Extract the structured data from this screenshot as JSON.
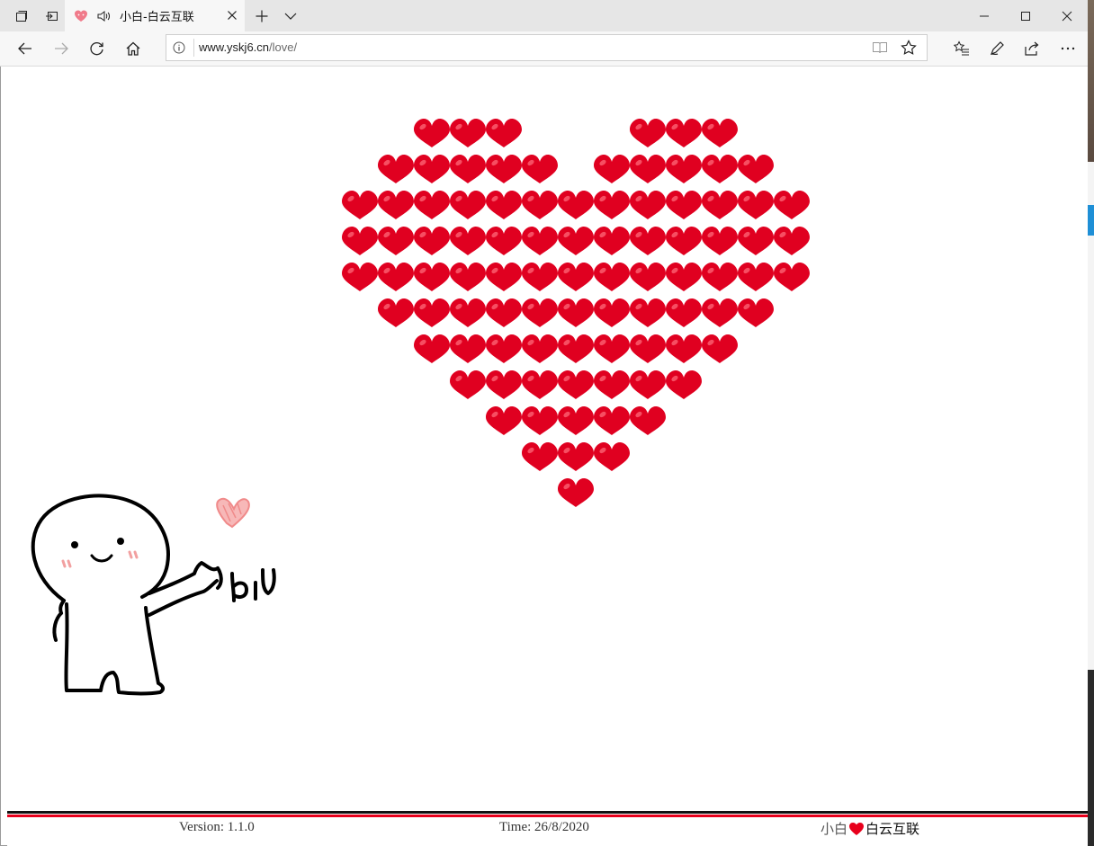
{
  "browser": {
    "tab": {
      "title": "小白-白云互联",
      "favicon": "heart-favicon-icon",
      "audio_icon": "speaker-icon"
    },
    "address": {
      "domain": "www.yskj6.cn",
      "path": "/love/"
    },
    "icons": {
      "tab_manager": "tab-manager-icon",
      "set_aside": "set-aside-tabs-icon",
      "new_tab": "plus-icon",
      "tab_list": "chevron-down-icon",
      "minimize": "minimize-icon",
      "maximize": "maximize-icon",
      "close": "close-icon",
      "back": "back-arrow-icon",
      "forward": "forward-arrow-icon",
      "refresh": "refresh-icon",
      "home": "home-icon",
      "reading_view": "reading-view-icon",
      "favorite": "star-icon",
      "favorites_hub": "favorites-list-icon",
      "notes": "pen-icon",
      "share": "share-icon",
      "more": "more-icon"
    }
  },
  "page": {
    "heart_color": "#e00020",
    "heart_rows": [
      3,
      5,
      13,
      13,
      13,
      11,
      9,
      7,
      5,
      3,
      1
    ],
    "figure": {
      "caption": "biu"
    },
    "footer": {
      "version_label": "Version: 1.1.0",
      "time_label": "Time: 26/8/2020",
      "brand_prefix": "小白",
      "brand_suffix": "白云互联"
    }
  }
}
